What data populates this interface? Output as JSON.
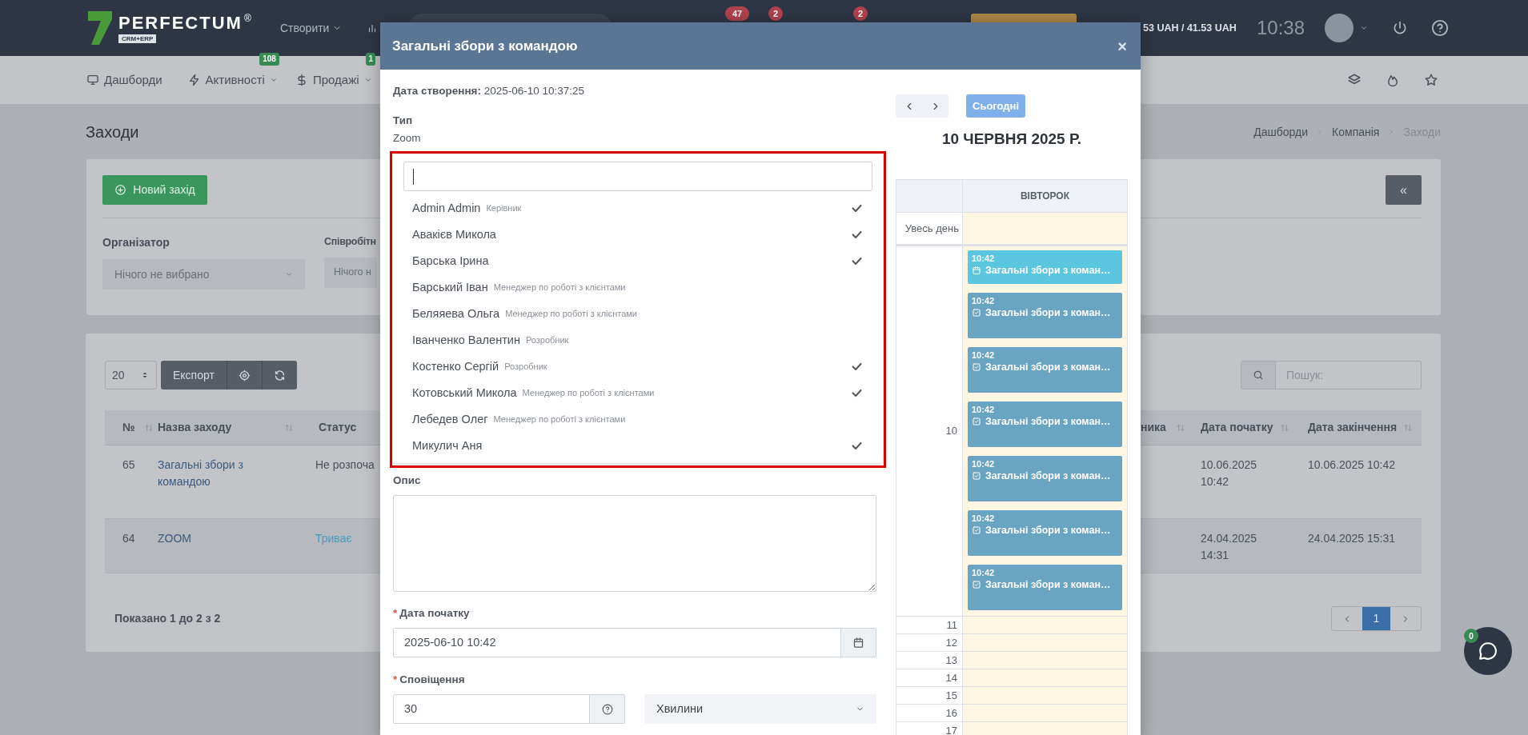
{
  "header": {
    "logo": {
      "name": "PERFECTUM",
      "registered": "®",
      "tagline": "CRM+ERP"
    },
    "create_menu": "Створити",
    "badges": [
      "47",
      "2",
      "2"
    ],
    "balance": "53 UAH / 41.53 UAH",
    "time": "10:38"
  },
  "nav": {
    "items": [
      {
        "label": "Дашборди",
        "has_menu": false
      },
      {
        "label": "Активності",
        "has_menu": true,
        "badge": "108"
      },
      {
        "label": "Продажі",
        "has_menu": true,
        "badge": "1"
      }
    ]
  },
  "page": {
    "title": "Заходи",
    "breadcrumb": [
      {
        "label": "Дашборди",
        "current": false
      },
      {
        "label": "Компанія",
        "current": false
      },
      {
        "label": "Заходи",
        "current": true
      }
    ]
  },
  "filters": {
    "new_button": "Новий захід",
    "collapse_button": "«",
    "fields": [
      {
        "label": "Організатор",
        "text": "Нічого не вибрано"
      },
      {
        "label": "Співробітн",
        "text": "Нічого н"
      }
    ]
  },
  "table": {
    "page_size": "20",
    "export_button": "Експорт",
    "search": {
      "placeholder": "Пошук:"
    },
    "columns": [
      "№",
      "Назва заходу",
      "Статус",
      "ника",
      "Дата початку",
      "Дата закінчення"
    ],
    "rows": [
      {
        "number": "65",
        "name": "Загальні збори з командою",
        "status": "Не розпоча",
        "color": "#4a5059",
        "start": "10.06.2025 10:42",
        "end": "10.06.2025 10:42",
        "striped": false
      },
      {
        "number": "64",
        "name": "ZOOM",
        "status": "Триває",
        "color": "#4a9bbf",
        "start": "24.04.2025 14:31",
        "end": "24.04.2025 15:31",
        "striped": true
      }
    ],
    "summary": "Показано 1 до 2 з 2",
    "pages": [
      {
        "label": "1",
        "selected": true
      }
    ]
  },
  "chat": {
    "badge": "0"
  },
  "modal": {
    "title": "Загальні збори з командою",
    "close": "×",
    "created": "**Дата створення:** 2025-06-10 10:37:25",
    "type_label": "Тип",
    "type_value": "Zoom",
    "participants": [
      {
        "name": "Admin Admin",
        "role": "Керівник",
        "checked": true
      },
      {
        "name": "Авакієв Микола",
        "checked": true
      },
      {
        "name": "Барська Ірина",
        "checked": true
      },
      {
        "name": "Барський Іван",
        "role": "Менеджер по роботі з клієнтами",
        "checked": false
      },
      {
        "name": "Беляяева Ольга",
        "role": "Менеджер по роботі з клієнтами",
        "checked": false
      },
      {
        "name": "Іванченко Валентин",
        "role": "Розробник",
        "checked": false
      },
      {
        "name": "Костенко Сергій",
        "role": "Розробник",
        "checked": true
      },
      {
        "name": "Котовський Микола",
        "role": "Менеджер по роботі з клієнтами",
        "checked": true
      },
      {
        "name": "Лебедев Олег",
        "role": "Менеджер по роботі з клієнтами",
        "checked": false
      },
      {
        "name": "Микулич Аня",
        "checked": true
      }
    ],
    "description_label": "Опис",
    "start": {
      "label": "Дата початку",
      "required_mark": "*",
      "value": "2025-06-10 10:42"
    },
    "notification": {
      "label": "Сповіщення",
      "required_mark": "*",
      "value": "30",
      "unit": "Хвилини"
    },
    "calendar": {
      "today_button": "Сьогодні",
      "title": "10 ЧЕРВНЯ 2025 Р.",
      "day": "ВІВТОРОК",
      "all_day": "Увесь день",
      "hours": [
        "10",
        "11",
        "12",
        "13",
        "14",
        "15",
        "16",
        "17"
      ],
      "events": [
        {
          "time": "10:42",
          "title": "Загальні збори з коман…",
          "kind": "meeting"
        },
        {
          "time": "10:42",
          "title": "Загальні збори з коман…",
          "kind": "task"
        },
        {
          "time": "10:42",
          "title": "Загальні збори з коман…",
          "kind": "task"
        },
        {
          "time": "10:42",
          "title": "Загальні збори з коман…",
          "kind": "task"
        },
        {
          "time": "10:42",
          "title": "Загальні збори з коман…",
          "kind": "task"
        },
        {
          "time": "10:42",
          "title": "Загальні збори з коман…",
          "kind": "task"
        },
        {
          "time": "10:42",
          "title": "Загальні збори з коман…",
          "kind": "task"
        }
      ]
    }
  }
}
